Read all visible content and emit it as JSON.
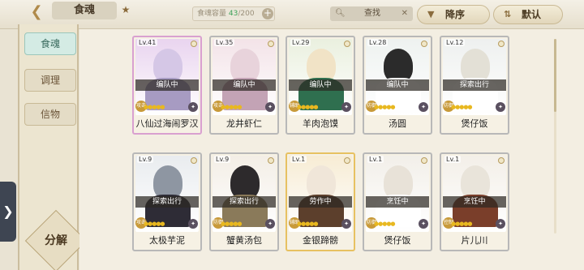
{
  "header": {
    "back_icon": "back-arrow-icon",
    "title": "食魂",
    "star_icon": "star-icon",
    "capacity_label": "食魂容量",
    "capacity_current": "43",
    "capacity_max": "/200",
    "search_label": "查找",
    "sort_label": "降序",
    "default_label": "默认"
  },
  "sidebar": {
    "tabs": [
      "食魂",
      "调理",
      "信物"
    ],
    "decompose": "分解"
  },
  "cards": [
    {
      "level": "Lv.41",
      "status": "编队中",
      "name": "八仙过海闹罗汉",
      "badge": "攻击",
      "frame": "rainbow"
    },
    {
      "level": "Lv.35",
      "status": "编队中",
      "name": "龙井虾仁",
      "badge": "攻击",
      "frame": "gray"
    },
    {
      "level": "Lv.29",
      "status": "编队中",
      "name": "羊肉泡馍",
      "badge": "辅助",
      "frame": "gray"
    },
    {
      "level": "Lv.28",
      "status": "编队中",
      "name": "汤圆",
      "badge": "防御",
      "frame": "gray"
    },
    {
      "level": "Lv.12",
      "status": "探索出行",
      "name": "煲仔饭",
      "badge": "防御",
      "frame": "gray"
    },
    {
      "level": "Lv.9",
      "status": "探索出行",
      "name": "太极芋泥",
      "badge": "攻击",
      "frame": "gray"
    },
    {
      "level": "Lv.9",
      "status": "探索出行",
      "name": "蟹黄汤包",
      "badge": "防御",
      "frame": "gray"
    },
    {
      "level": "Lv.1",
      "status": "劳作中",
      "name": "金银蹄髈",
      "badge": "辅助",
      "frame": "gold"
    },
    {
      "level": "Lv.1",
      "status": "烹饪中",
      "name": "煲仔饭",
      "badge": "防御",
      "frame": "gray"
    },
    {
      "level": "Lv.1",
      "status": "烹饪中",
      "name": "片儿川",
      "badge": "控制",
      "frame": "gray"
    }
  ]
}
